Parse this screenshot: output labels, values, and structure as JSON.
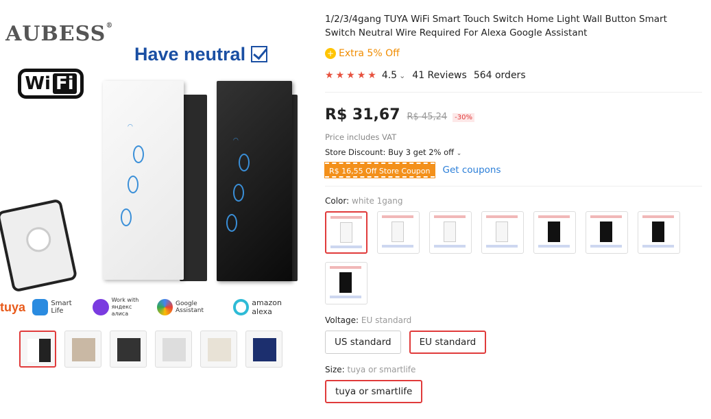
{
  "gallery": {
    "brand": "AUBESS",
    "brand_mark": "®",
    "wifi_logo": {
      "left": "Wi",
      "right": "Fi"
    },
    "headline": "Have neutral",
    "logos": [
      {
        "name": "tuya",
        "text": "tuya"
      },
      {
        "name": "smart-life",
        "text": "Smart Life"
      },
      {
        "name": "yandex",
        "text": "Work with яндекс алиса"
      },
      {
        "name": "google-assistant",
        "text": "Google Assistant"
      },
      {
        "name": "amazon-alexa",
        "text": "amazon alexa"
      }
    ],
    "thumbnails": [
      {
        "selected": true
      },
      {
        "selected": false
      },
      {
        "selected": false
      },
      {
        "selected": false
      },
      {
        "selected": false
      },
      {
        "selected": false
      }
    ]
  },
  "product": {
    "title": "1/2/3/4gang TUYA WiFi Smart Touch Switch Home Light Wall Button Smart Switch Neutral Wire Required For Alexa Google Assistant",
    "extra_off": "Extra 5% Off",
    "rating": "4.5",
    "reviews": "41 Reviews",
    "orders": "564 orders",
    "price": "R$ 31,67",
    "old_price": "R$ 45,24",
    "discount": "-30%",
    "vat_note": "Price includes VAT",
    "store_discount": "Store Discount: Buy 3 get 2% off",
    "coupon": "R$ 16,55 Off Store Coupon",
    "get_coupons": "Get coupons"
  },
  "color": {
    "label": "Color:",
    "value": "white 1gang",
    "swatches": [
      {
        "tone": "white",
        "selected": true
      },
      {
        "tone": "white",
        "selected": false
      },
      {
        "tone": "white",
        "selected": false
      },
      {
        "tone": "white",
        "selected": false
      },
      {
        "tone": "black",
        "selected": false
      },
      {
        "tone": "black",
        "selected": false
      },
      {
        "tone": "black",
        "selected": false
      },
      {
        "tone": "black",
        "selected": false
      }
    ]
  },
  "voltage": {
    "label": "Voltage:",
    "value": "EU standard",
    "options": [
      {
        "label": "US standard",
        "selected": false
      },
      {
        "label": "EU standard",
        "selected": true
      }
    ]
  },
  "size": {
    "label": "Size:",
    "value": "tuya or smartlife",
    "options": [
      {
        "label": "tuya or smartlife",
        "selected": true
      }
    ]
  },
  "colors": {
    "accent": "#e03a3a",
    "coupon": "#f3901a",
    "link": "#2a7ed8",
    "star": "#e7513e"
  }
}
